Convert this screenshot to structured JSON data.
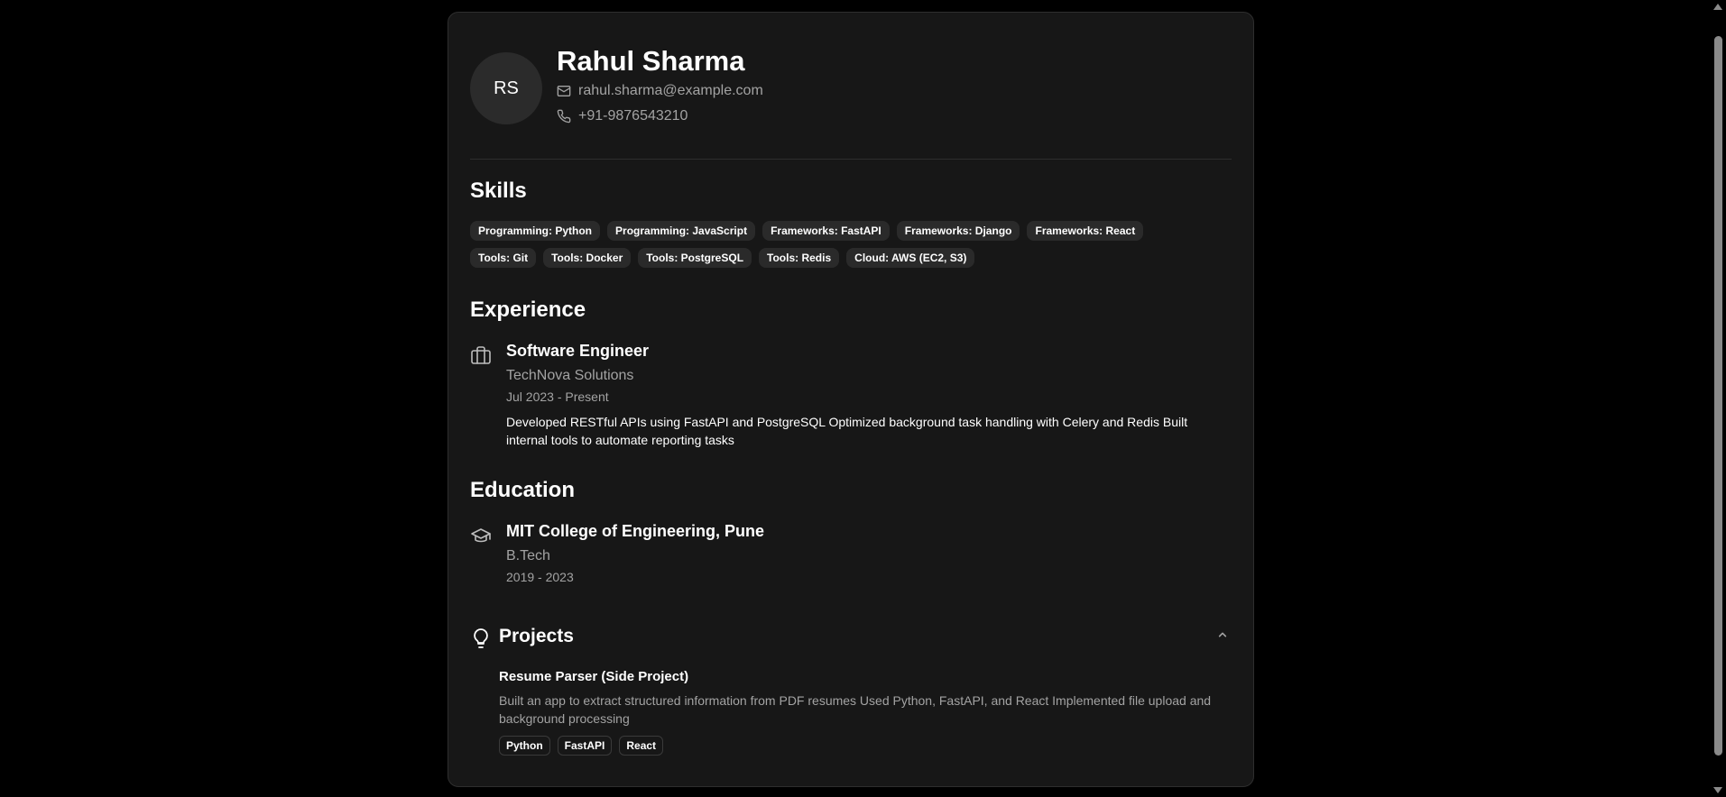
{
  "profile": {
    "initials": "RS",
    "name": "Rahul Sharma",
    "email": "rahul.sharma@example.com",
    "phone": "+91-9876543210"
  },
  "skills": {
    "title": "Skills",
    "items": [
      "Programming: Python",
      "Programming: JavaScript",
      "Frameworks: FastAPI",
      "Frameworks: Django",
      "Frameworks: React",
      "Tools: Git",
      "Tools: Docker",
      "Tools: PostgreSQL",
      "Tools: Redis",
      "Cloud: AWS (EC2, S3)"
    ]
  },
  "experience": {
    "title": "Experience",
    "items": [
      {
        "role": "Software Engineer",
        "company": "TechNova Solutions",
        "dates": "Jul 2023 - Present",
        "description": "Developed RESTful APIs using FastAPI and PostgreSQL Optimized background task handling with Celery and Redis Built internal tools to automate reporting tasks"
      }
    ]
  },
  "education": {
    "title": "Education",
    "items": [
      {
        "school": "MIT College of Engineering, Pune",
        "degree": "B.Tech",
        "dates": "2019 - 2023"
      }
    ]
  },
  "projects": {
    "title": "Projects",
    "expanded": true,
    "items": [
      {
        "name": "Resume Parser (Side Project)",
        "description": "Built an app to extract structured information from PDF resumes Used Python, FastAPI, and React Implemented file upload and background processing",
        "tags": [
          "Python",
          "FastAPI",
          "React"
        ]
      }
    ]
  },
  "icons": {
    "email": "mail-icon",
    "phone": "phone-icon",
    "experience": "briefcase-icon",
    "education": "graduation-cap-icon",
    "projects": "lightbulb-icon",
    "toggle": "chevron-up-icon"
  }
}
